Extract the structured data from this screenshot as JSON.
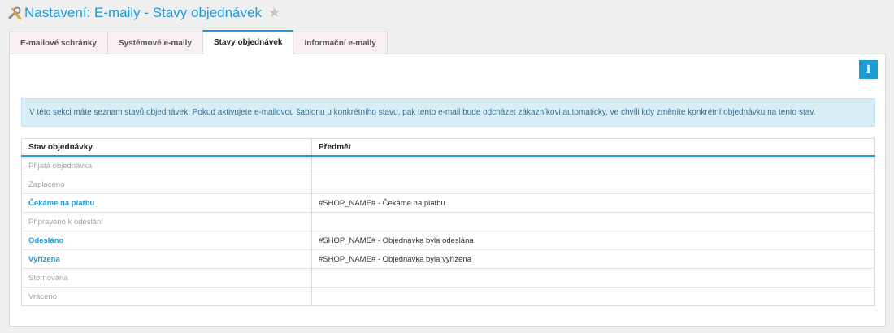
{
  "header": {
    "title": "Nastavení: E-maily - Stavy objednávek",
    "icon": "tools-icon",
    "favorite_icon": "star-icon"
  },
  "tabs": [
    {
      "label": "E-mailové schránky",
      "active": false
    },
    {
      "label": "Systémové e-maily",
      "active": false
    },
    {
      "label": "Stavy objednávek",
      "active": true
    },
    {
      "label": "Informační e-maily",
      "active": false
    }
  ],
  "info_button": {
    "icon": "info-icon",
    "glyph": "i"
  },
  "alert": {
    "text": "V této sekci máte seznam stavů objednávek. Pokud aktivujete e-mailovou šablonu u konkrétního stavu, pak tento e-mail bude odcházet zákazníkovi automaticky, ve chvíli kdy změníte konkrétní objednávku na tento stav."
  },
  "table": {
    "headers": {
      "state": "Stav objednávky",
      "subject": "Předmět"
    },
    "rows": [
      {
        "state": "Přijatá objednávka",
        "subject": ""
      },
      {
        "state": "Zaplaceno",
        "subject": ""
      },
      {
        "state": "Čekáme na platbu",
        "subject": "#SHOP_NAME# - Čekáme na platbu"
      },
      {
        "state": "Připraveno k odeslání",
        "subject": ""
      },
      {
        "state": "Odesláno",
        "subject": "#SHOP_NAME# - Objednávka byla odeslána"
      },
      {
        "state": "Vyřízena",
        "subject": "#SHOP_NAME# - Objednávka byla vyřízena"
      },
      {
        "state": "Stornována",
        "subject": ""
      },
      {
        "state": "Vráceno",
        "subject": ""
      }
    ]
  },
  "colors": {
    "accent": "#1e9ad6",
    "muted": "#a5a5a5",
    "alert_bg": "#d9edf7"
  }
}
